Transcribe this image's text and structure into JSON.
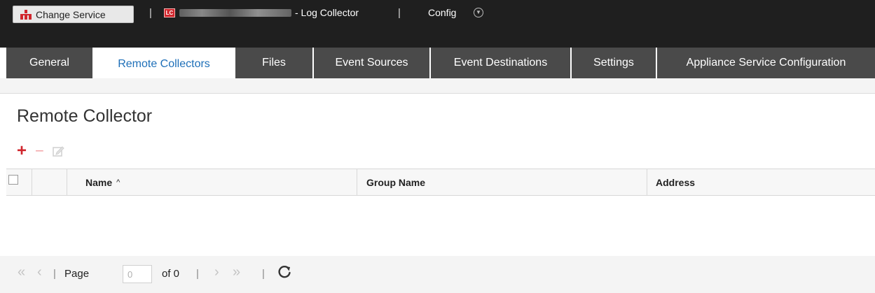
{
  "header": {
    "change_service_label": "Change Service",
    "badge": "LC",
    "collector_suffix": "- Log Collector",
    "view_label": "Config",
    "separator": "|"
  },
  "tabs": [
    {
      "label": "General",
      "active": false
    },
    {
      "label": "Remote Collectors",
      "active": true
    },
    {
      "label": "Files",
      "active": false
    },
    {
      "label": "Event Sources",
      "active": false
    },
    {
      "label": "Event Destinations",
      "active": false
    },
    {
      "label": "Settings",
      "active": false
    },
    {
      "label": "Appliance Service Configuration",
      "active": false
    }
  ],
  "page": {
    "title": "Remote Collector"
  },
  "toolbar": {
    "add": "+",
    "remove": "−"
  },
  "table": {
    "columns": [
      {
        "label": "Name",
        "sort": "^"
      },
      {
        "label": "Group Name"
      },
      {
        "label": "Address"
      }
    ],
    "rows": []
  },
  "pager": {
    "first": "«",
    "prev": "‹",
    "page_label": "Page",
    "page_value": "0",
    "of_label": "of 0",
    "next": "›",
    "last": "»",
    "separator": "|"
  },
  "colors": {
    "accent_red": "#d0262d",
    "tab_dark": "#4a4a4a",
    "tab_active_text": "#1e6fb8",
    "header_bg": "#1f1f1f"
  }
}
